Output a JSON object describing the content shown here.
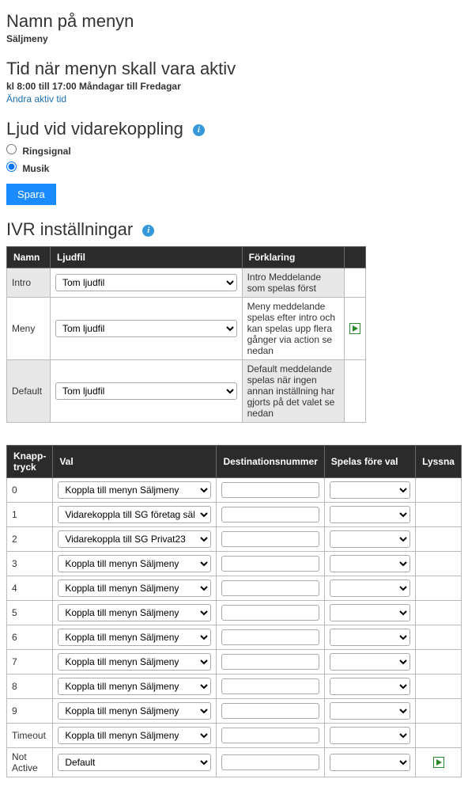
{
  "section1": {
    "title": "Namn på menyn",
    "value": "Säljmeny"
  },
  "section2": {
    "title": "Tid när menyn skall vara aktiv",
    "value": "kl 8:00 till 17:00 Måndagar till Fredagar",
    "link": "Ändra aktiv tid"
  },
  "section3": {
    "title": "Ljud vid vidarekoppling",
    "opt1": "Ringsignal",
    "opt2": "Musik"
  },
  "save_label": "Spara",
  "ivr_title": "IVR inställningar",
  "t1": {
    "h1": "Namn",
    "h2": "Ljudfil",
    "h3": "Förklaring",
    "rows": [
      {
        "name": "Intro",
        "file": "Tom ljudfil",
        "desc": "Intro Meddelande som spelas först",
        "play": false
      },
      {
        "name": "Meny",
        "file": "Tom ljudfil",
        "desc": "Meny meddelande spelas efter intro och kan spelas upp flera gånger via action se nedan",
        "play": true
      },
      {
        "name": "Default",
        "file": "Tom ljudfil",
        "desc": "Default meddelande spelas när ingen annan inställning har gjorts på det valet se nedan",
        "play": false
      }
    ]
  },
  "t2": {
    "h1": "Knapp-tryck",
    "h2": "Val",
    "h3": "Destinationsnummer",
    "h4": "Spelas före val",
    "h5": "Lyssna",
    "rows": [
      {
        "key": "0",
        "val": "Koppla till menyn Säljmeny",
        "play": false
      },
      {
        "key": "1",
        "val": "Vidarekoppla till SG företag sälj",
        "play": false
      },
      {
        "key": "2",
        "val": "Vidarekoppla till SG Privat23",
        "play": false
      },
      {
        "key": "3",
        "val": "Koppla till menyn Säljmeny",
        "play": false
      },
      {
        "key": "4",
        "val": "Koppla till menyn Säljmeny",
        "play": false
      },
      {
        "key": "5",
        "val": "Koppla till menyn Säljmeny",
        "play": false
      },
      {
        "key": "6",
        "val": "Koppla till menyn Säljmeny",
        "play": false
      },
      {
        "key": "7",
        "val": "Koppla till menyn Säljmeny",
        "play": false
      },
      {
        "key": "8",
        "val": "Koppla till menyn Säljmeny",
        "play": false
      },
      {
        "key": "9",
        "val": "Koppla till menyn Säljmeny",
        "play": false
      },
      {
        "key": "Timeout",
        "val": "Koppla till menyn Säljmeny",
        "play": false
      },
      {
        "key": "Not Active",
        "val": "Default",
        "play": true
      }
    ]
  }
}
